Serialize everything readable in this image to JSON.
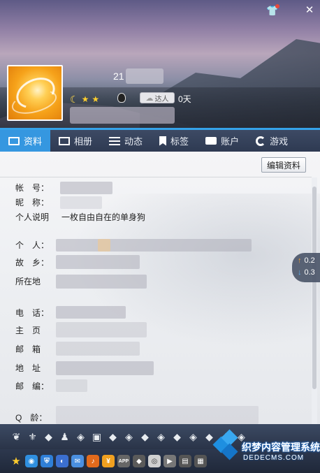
{
  "window": {
    "skin_icon": "shirt-icon",
    "close_icon": "close-icon",
    "close_glyph": "✕"
  },
  "profile": {
    "qq_number_visible": "21",
    "days_label": "0天",
    "talent_badge": "达人"
  },
  "tabs": [
    {
      "label": "资料",
      "icon": "profile-card-icon",
      "active": true
    },
    {
      "label": "相册",
      "icon": "photo-album-icon",
      "active": false
    },
    {
      "label": "动态",
      "icon": "feed-list-icon",
      "active": false
    },
    {
      "label": "标签",
      "icon": "bookmark-tag-icon",
      "active": false
    },
    {
      "label": "账户",
      "icon": "wallet-icon",
      "active": false
    },
    {
      "label": "游戏",
      "icon": "game-icon",
      "active": false
    }
  ],
  "toolbar": {
    "edit_label": "编辑资料"
  },
  "fields": {
    "account": {
      "label": "帐　号：",
      "value": ""
    },
    "nickname": {
      "label": "昵　称：",
      "value": ""
    },
    "bio": {
      "label": "个人说明",
      "value": "一枚自由自在的单身狗"
    },
    "personal": {
      "label": "个　人："
    },
    "hometown": {
      "label": "故　乡："
    },
    "location": {
      "label": "所在地"
    },
    "phone": {
      "label": "电　话："
    },
    "homepage": {
      "label": "主　页"
    },
    "email": {
      "label": "邮　箱"
    },
    "address": {
      "label": "地　址"
    },
    "postcode": {
      "label": "邮　编："
    },
    "qage": {
      "label": "Q　龄："
    }
  },
  "net_speed": {
    "up": "0.2",
    "down": "0.3"
  },
  "watermark": {
    "text": "织梦内容管理系统",
    "url": "DEDECMS.COM"
  },
  "colors": {
    "accent": "#3597e0",
    "tab_bar": "#2e3a52",
    "bottom_bar": "#2a3448"
  }
}
